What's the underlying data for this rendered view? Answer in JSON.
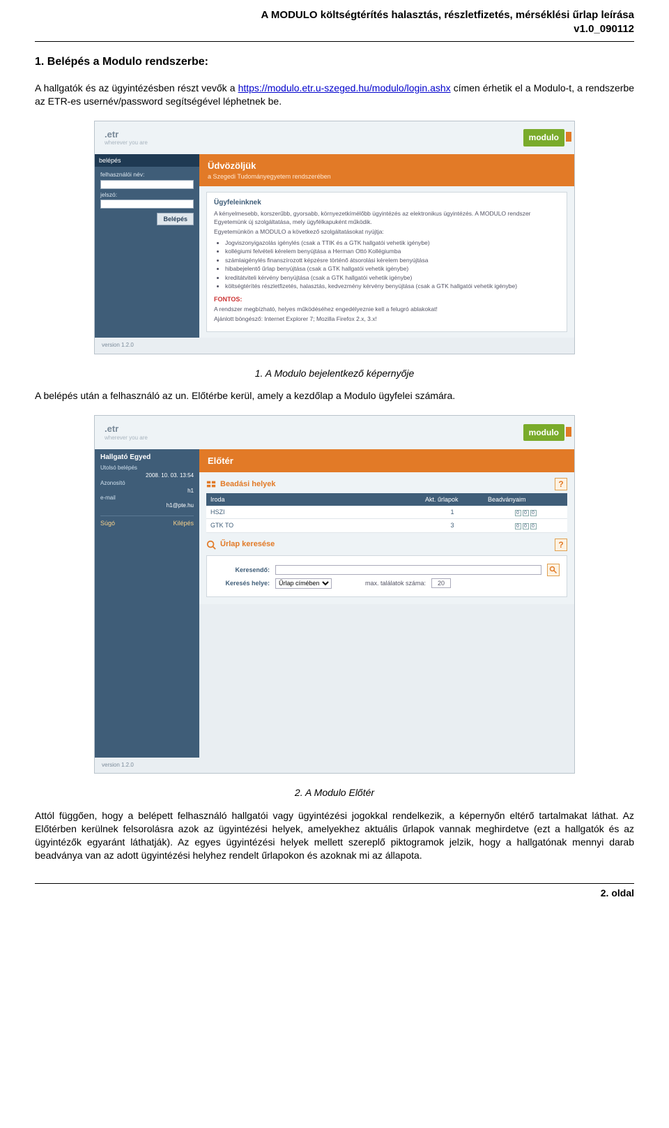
{
  "header": {
    "title": "A MODULO költségtérítés halasztás, részletfizetés, mérséklési űrlap leírása",
    "version": "v1.0_090112"
  },
  "section1": {
    "heading": "1. Belépés a Modulo rendszerbe:",
    "para_a": "A hallgatók és az ügyintézésben részt vevők a ",
    "link": "https://modulo.etr.u-szeged.hu/modulo/login.ashx",
    "para_b": " címen érhetik el a Modulo-t, a rendszerbe az ETR-es usernév/password segítségével léphetnek be.",
    "caption1": "1. A Modulo bejelentkező képernyője",
    "mid": "A belépés után a felhasználó az un. Előtérbe kerül, amely a kezdőlap a Modulo ügyfelei számára.",
    "caption2": "2. A Modulo Előtér",
    "tail": "Attól függően, hogy a belépett felhasználó hallgatói vagy ügyintézési jogokkal rendelkezik, a képernyőn eltérő tartalmakat láthat. Az Előtérben kerülnek felsorolásra azok az ügyintézési helyek, amelyekhez aktuális űrlapok vannak meghirdetve (ezt a hallgatók és az ügyintézők egyaránt láthatják). Az egyes ügyintézési helyek mellett szereplő piktogramok jelzik, hogy a hallgatónak mennyi darab beadványa van az adott ügyintézési helyhez rendelt űrlapokon és azoknak mi az állapota."
  },
  "shot1": {
    "brand_etr": ".etr",
    "brand_sub": "wherever you are",
    "brand_modulo": "modulo",
    "side_title": "belépés",
    "lab_user": "felhasználói név:",
    "lab_pass": "jelszó:",
    "btn": "Belépés",
    "banner_big": "Üdvözöljük",
    "banner_small": "a Szegedi Tudományegyetem rendszerében",
    "panel_head": "Ügyfeleinknek",
    "panel_p1": "A kényelmesebb, korszerűbb, gyorsabb, környezetkímélőbb ügyintézés az elektronikus ügyintézés. A MODULO rendszer Egyetemünk új szolgáltatása, mely ügyfélkapuként működik.",
    "panel_p2": "Egyetemünkön a MODULO a következő szolgáltatásokat nyújtja:",
    "bullets": [
      "Jogviszonyigazolás igénylés (csak a TTIK és a GTK hallgatói vehetik igénybe)",
      "kollégiumi felvételi kérelem benyújtása a Herman Ottó Kollégiumba",
      "számlaigénylés finanszírozott képzésre történő átsorolási kérelem benyújtása",
      "hibabejelentő űrlap benyújtása (csak a GTK hallgatói vehetik igénybe)",
      "kreditátviteli kérvény benyújtása (csak a GTK hallgatói vehetik igénybe)",
      "költségtérítés részletfizetés, halasztás, kedvezmény kérvény benyújtása (csak a GTK hallgatói vehetik igénybe)"
    ],
    "fontos": "FONTOS:",
    "fontos_p1": "A rendszer megbízható, helyes működéséhez engedélyeznie kell a felugró ablakokat!",
    "fontos_p2": "Ajánlott böngésző: Internet Explorer 7; Mozilla Firefox 2.x, 3.x!",
    "version": "version 1.2.0"
  },
  "shot2": {
    "brand_etr": ".etr",
    "brand_sub": "wherever you are",
    "brand_modulo": "modulo",
    "user": "Hallgató Egyed",
    "k_last": "Utolsó belépés",
    "v_last": "2008. 10. 03. 13:54",
    "k_id": "Azonosító",
    "v_id": "h1",
    "k_mail": "e-mail",
    "v_mail": "h1@pte.hu",
    "link_help": "Súgó",
    "link_out": "Kilépés",
    "banner": "Előtér",
    "places_head": "Beadási helyek",
    "th_iroda": "Iroda",
    "th_akt": "Akt. űrlapok",
    "th_bead": "Beadványaim",
    "rows": [
      {
        "name": "HSZI",
        "akt": "1"
      },
      {
        "name": "GTK TO",
        "akt": "3"
      }
    ],
    "search_head": "Űrlap keresése",
    "lab_kw": "Keresendő:",
    "lab_where": "Keresés helye:",
    "sel_where": "Űrlap címében",
    "lab_max": "max. találatok száma:",
    "val_max": "20",
    "version": "version 1.2.0"
  },
  "footer": {
    "page": "2. oldal"
  }
}
